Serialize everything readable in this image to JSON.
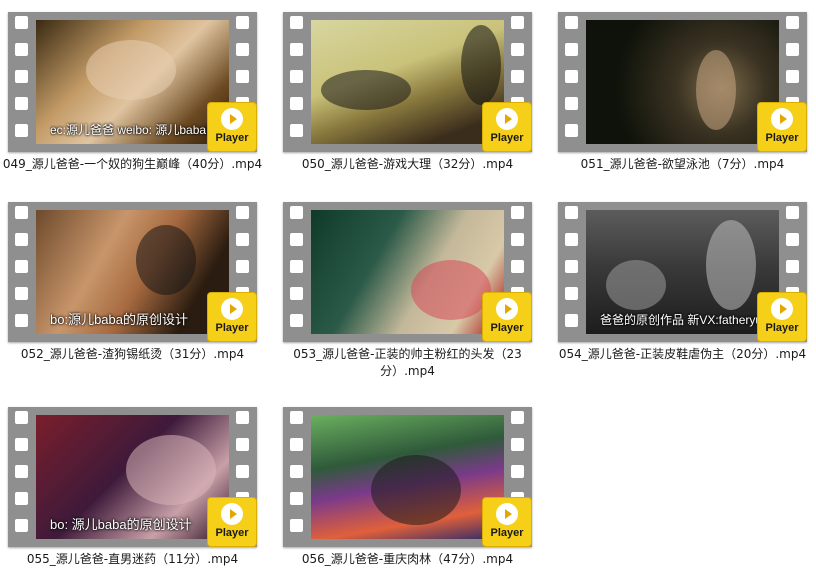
{
  "player_label": "Player",
  "tiles": [
    {
      "filename": "049_源儿爸爸-一个奴的狗生巅峰（40分）.mp4",
      "caption": "ec:源儿爸爸    weibo: 源儿baba的原创",
      "scene_color": "#c29a66"
    },
    {
      "filename": "050_源儿爸爸-游戏大理（32分）.mp4",
      "caption": "",
      "scene_color": "#c9c27a"
    },
    {
      "filename": "051_源儿爸爸-欲望泳池（7分）.mp4",
      "caption": "",
      "scene_color": "#3a3222"
    },
    {
      "filename": "052_源儿爸爸-渣狗锡纸烫（31分）.mp4",
      "caption": "bo:源儿baba的原创设计",
      "scene_color": "#c8956a"
    },
    {
      "filename": "053_源儿爸爸-正装的帅主粉红的头发（23分）.mp4",
      "caption": "",
      "scene_color": "#2b5a48"
    },
    {
      "filename": "054_源儿爸爸-正装皮鞋虐伪主（20分）.mp4",
      "caption": "爸爸的原创作品 新VX:fatheryuan",
      "scene_color": "#3a3a3a"
    },
    {
      "filename": "055_源儿爸爸-直男迷药（11分）.mp4",
      "caption": "bo: 源儿baba的原创设计",
      "scene_color": "#7a1e2c"
    },
    {
      "filename": "056_源儿爸爸-重庆肉林（47分）.mp4",
      "caption": "",
      "scene_color": "#2f5a3a"
    }
  ]
}
